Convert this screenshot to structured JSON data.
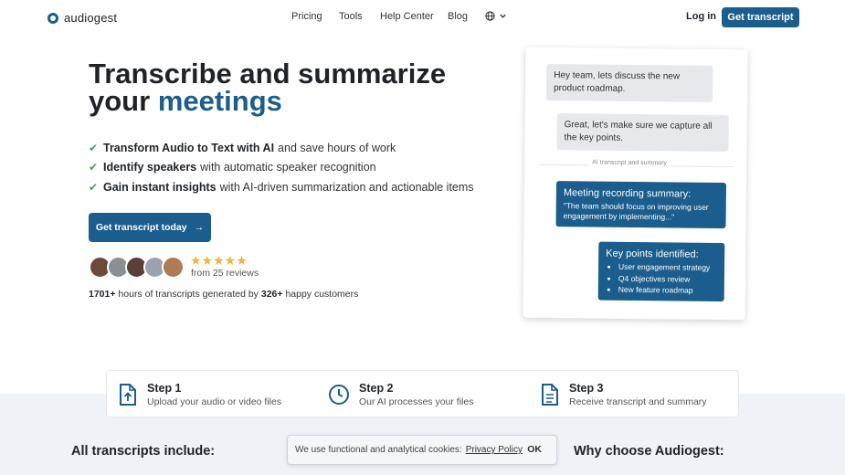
{
  "nav": {
    "logo_text": "audiogest",
    "links": [
      "Pricing",
      "Tools",
      "Help Center",
      "Blog"
    ],
    "login": "Log in",
    "cta": "Get transcript"
  },
  "hero": {
    "title_line1": "Transcribe and summarize",
    "title_line2_plain": "your",
    "title_line2_accent": "meetings",
    "features": [
      {
        "bold": "Transform Audio to Text with AI",
        "rest": "and save hours of work"
      },
      {
        "bold": "Identify speakers",
        "rest": "with automatic speaker recognition"
      },
      {
        "bold": "Gain instant insights",
        "rest": "with AI-driven summarization and actionable items"
      }
    ],
    "cta": "Get transcript today",
    "stars": "★★★★★",
    "rating": 5,
    "reviews": "from 25 reviews",
    "hours_num": "1701+",
    "hours_mid": "hours of transcripts generated by",
    "customers_num": "326+",
    "customers_tail": "happy customers"
  },
  "chat": {
    "msg1": "Hey team, lets discuss the new product roadmap.",
    "msg2": "Great, let's make sure we capture all the key points.",
    "divider": "AI transcript and summary",
    "summary_title": "Meeting recording summary:",
    "summary_text": "\"The team should focus on improving user engagement by implementing...\"",
    "keypoints_title": "Key points identified:",
    "keypoints": [
      "User engagement strategy",
      "Q4 objectives review",
      "New feature roadmap"
    ]
  },
  "steps": [
    {
      "title": "Step 1",
      "desc": "Upload your audio or video files",
      "icon": "file-upload-icon"
    },
    {
      "title": "Step 2",
      "desc": "Our AI processes your files",
      "icon": "clock-icon"
    },
    {
      "title": "Step 3",
      "desc": "Receive transcript and summary",
      "icon": "document-icon"
    }
  ],
  "sections": {
    "left_title": "All transcripts include:",
    "right_title": "Why choose Audiogest:"
  },
  "cookie": {
    "text": "We use functional and analytical cookies:",
    "link": "Privacy Policy",
    "ok": "OK"
  },
  "colors": {
    "brand": "#1b5d8c",
    "check": "#3aa35b",
    "star": "#f2b33d"
  }
}
